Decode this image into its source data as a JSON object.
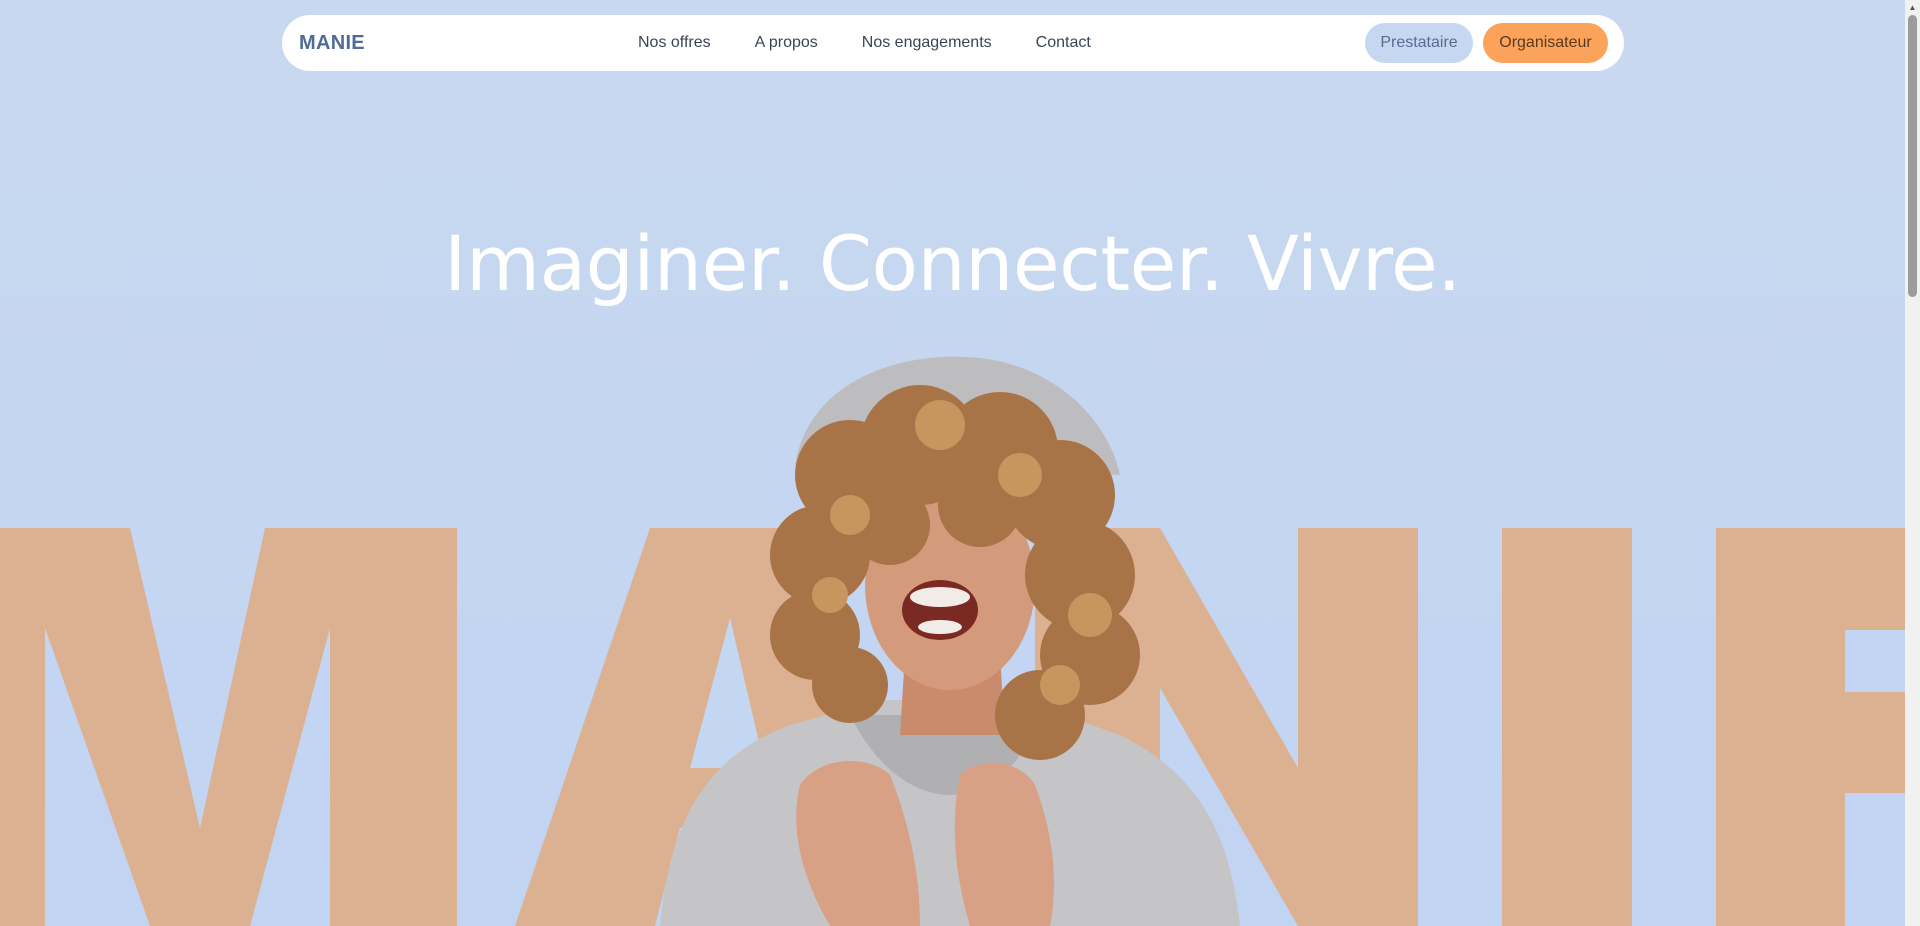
{
  "navbar": {
    "logo": "MANIE",
    "links": [
      "Nos offres",
      "A propos",
      "Nos engagements",
      "Contact"
    ],
    "btn_prestataire": "Prestataire",
    "btn_organisateur": "Organisateur"
  },
  "hero": {
    "headline": "Imaginer. Connecter. Vivre.",
    "background_word": "MANIE",
    "image_alt": "Laughing woman with curly hair wearing a grey hoodie"
  },
  "colors": {
    "background": "#c8d8f0",
    "accent_orange": "#fba35a",
    "big_letters": "#dcb191",
    "logo_blue": "#4f6c98"
  },
  "icons": {
    "scroll_up": "scroll-up-arrow-icon"
  }
}
